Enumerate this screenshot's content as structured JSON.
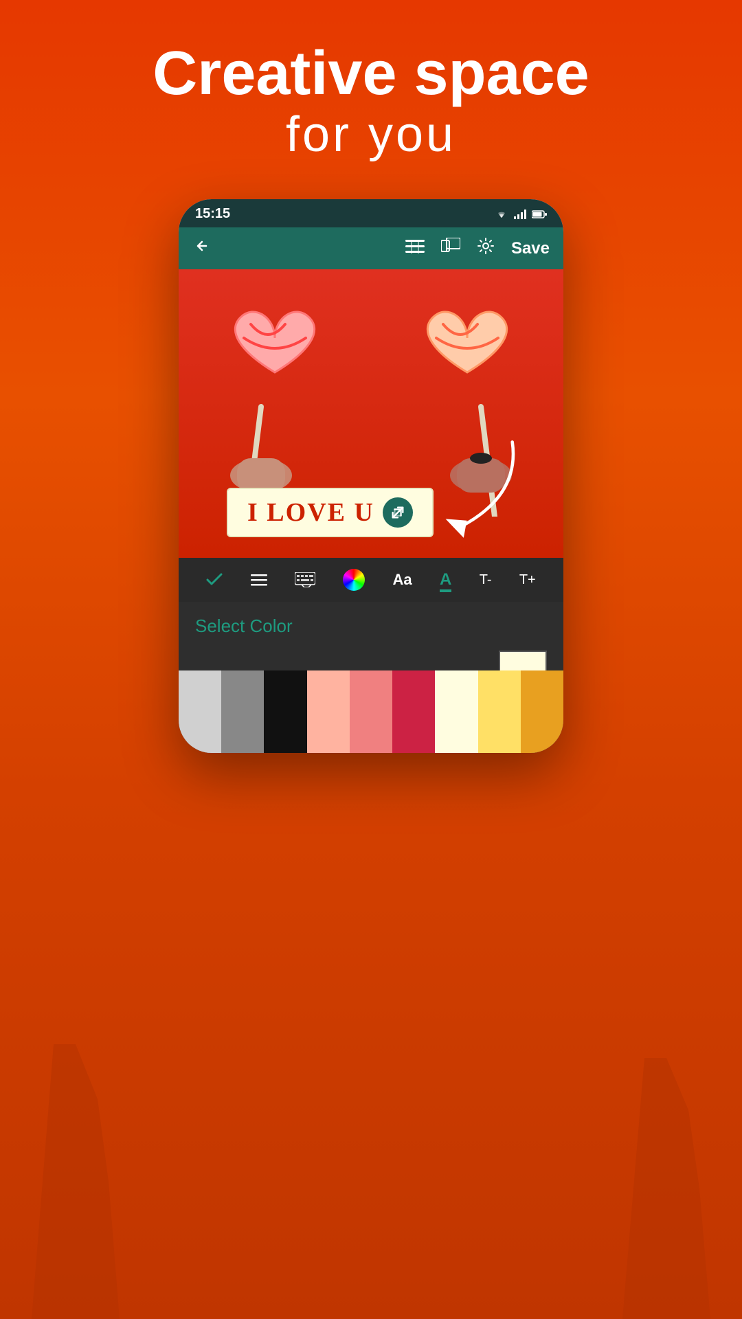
{
  "header": {
    "line1": "Creative space",
    "line2": "for  you"
  },
  "status_bar": {
    "time": "15:15",
    "icons": [
      "wifi",
      "signal",
      "battery"
    ]
  },
  "toolbar": {
    "back_label": "←",
    "save_label": "Save",
    "menu_icon": "menu",
    "gallery_icon": "gallery",
    "settings_icon": "settings"
  },
  "canvas": {
    "text": "I LOVE U"
  },
  "edit_tools": [
    {
      "name": "check",
      "symbol": "✓"
    },
    {
      "name": "list",
      "symbol": "☰"
    },
    {
      "name": "keyboard",
      "symbol": "⌨"
    },
    {
      "name": "color-wheel",
      "symbol": ""
    },
    {
      "name": "font-size",
      "symbol": "Aa"
    },
    {
      "name": "highlight",
      "symbol": "A"
    },
    {
      "name": "text-minus",
      "symbol": "T-"
    },
    {
      "name": "text-plus",
      "symbol": "T+"
    }
  ],
  "color_section": {
    "label": "Select Color"
  },
  "swatches": [
    {
      "color": "#d0d0d0",
      "label": "light-gray"
    },
    {
      "color": "#888888",
      "label": "gray"
    },
    {
      "color": "#111111",
      "label": "black"
    },
    {
      "color": "#ffb3a0",
      "label": "light-pink"
    },
    {
      "color": "#f08080",
      "label": "salmon"
    },
    {
      "color": "#cc2244",
      "label": "crimson"
    },
    {
      "color": "#fffde0",
      "label": "cream"
    },
    {
      "color": "#ffe066",
      "label": "yellow"
    },
    {
      "color": "#e8a020",
      "label": "orange"
    }
  ]
}
